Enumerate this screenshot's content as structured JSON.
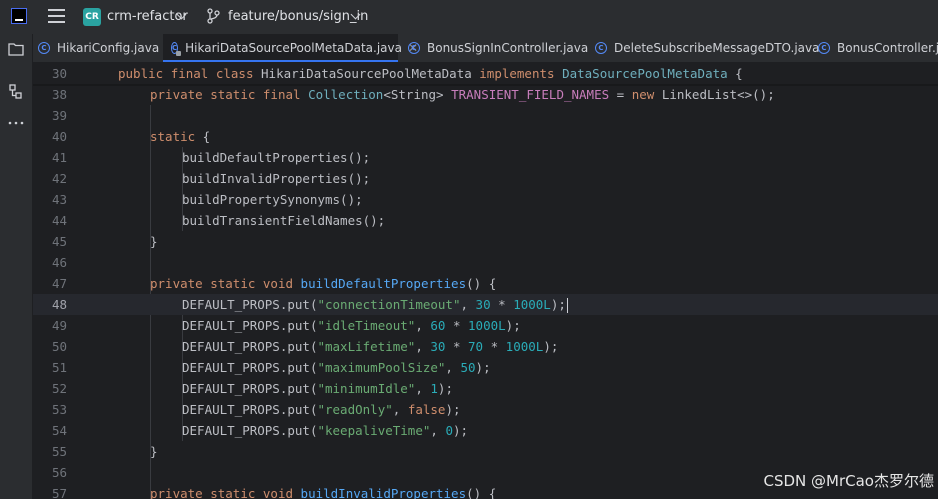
{
  "titlebar": {
    "project_badge": "CR",
    "project_name": "crm-refactor",
    "branch": "feature/bonus/sign_in"
  },
  "tabs": [
    {
      "label": "HikariConfig.java",
      "active": false,
      "locked": false
    },
    {
      "label": "HikariDataSourcePoolMetaData.java",
      "active": true,
      "locked": true
    },
    {
      "label": "BonusSignInController.java",
      "active": false,
      "locked": false
    },
    {
      "label": "DeleteSubscribeMessageDTO.java",
      "active": false,
      "locked": false
    },
    {
      "label": "BonusController.java",
      "active": false,
      "locked": false
    }
  ],
  "editor": {
    "sticky_line": {
      "num": "30",
      "text": "public final class HikariDataSourcePoolMetaData implements DataSourcePoolMetaData {"
    },
    "lines": [
      {
        "num": "38",
        "text": "private static final Collection<String> TRANSIENT_FIELD_NAMES = new LinkedList<>();"
      },
      {
        "num": "39",
        "text": ""
      },
      {
        "num": "40",
        "text": "static {"
      },
      {
        "num": "41",
        "text": "buildDefaultProperties();"
      },
      {
        "num": "42",
        "text": "buildInvalidProperties();"
      },
      {
        "num": "43",
        "text": "buildPropertySynonyms();"
      },
      {
        "num": "44",
        "text": "buildTransientFieldNames();"
      },
      {
        "num": "45",
        "text": "}"
      },
      {
        "num": "46",
        "text": ""
      },
      {
        "num": "47",
        "text": "private static void buildDefaultProperties() {"
      },
      {
        "num": "48",
        "text": "DEFAULT_PROPS.put(\"connectionTimeout\", 30 * 1000L);"
      },
      {
        "num": "49",
        "text": "DEFAULT_PROPS.put(\"idleTimeout\", 60 * 1000L);"
      },
      {
        "num": "50",
        "text": "DEFAULT_PROPS.put(\"maxLifetime\", 30 * 70 * 1000L);"
      },
      {
        "num": "51",
        "text": "DEFAULT_PROPS.put(\"maximumPoolSize\", 50);"
      },
      {
        "num": "52",
        "text": "DEFAULT_PROPS.put(\"minimumIdle\", 1);"
      },
      {
        "num": "53",
        "text": "DEFAULT_PROPS.put(\"readOnly\", false);"
      },
      {
        "num": "54",
        "text": "DEFAULT_PROPS.put(\"keepaliveTime\", 0);"
      },
      {
        "num": "55",
        "text": "}"
      },
      {
        "num": "56",
        "text": ""
      },
      {
        "num": "57",
        "text": "private static void buildInvalidProperties() {"
      }
    ],
    "current_line": "48"
  },
  "watermark": "CSDN @MrCao杰罗尔德",
  "colors": {
    "accent": "#3574f0",
    "keyword": "#cf8e6d",
    "string": "#6aab73",
    "number": "#2aacb8",
    "function": "#56a8f5",
    "field": "#c77dbb"
  }
}
